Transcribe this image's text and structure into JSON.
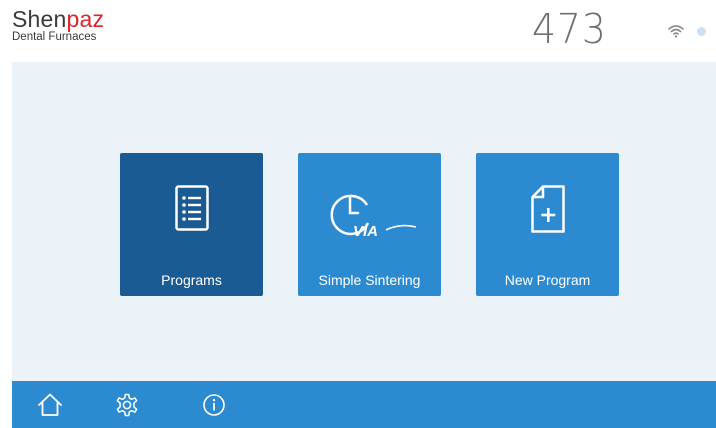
{
  "header": {
    "brand": {
      "name_main": "Shen",
      "name_accent": "paz",
      "subtitle": "Dental Furnaces"
    },
    "counter": "473",
    "icons": [
      "wifi-icon",
      "status-dot-icon"
    ]
  },
  "main": {
    "tiles": [
      {
        "label": "Programs",
        "icon": "list-document-icon",
        "color": "#1a5b93"
      },
      {
        "label": "Simple Sintering",
        "icon": "clock-via-icon",
        "icon_text": "VIA",
        "color": "#2b8ad0"
      },
      {
        "label": "New Program",
        "icon": "new-document-icon",
        "color": "#2b8ad0"
      }
    ]
  },
  "bottom_bar": {
    "buttons": [
      {
        "icon": "home-icon"
      },
      {
        "icon": "gear-icon"
      },
      {
        "icon": "info-icon"
      }
    ]
  },
  "colors": {
    "accent_red": "#d9262c",
    "primary_blue": "#2b8ad0",
    "dark_blue": "#1a5b93",
    "panel_bg": "#ebf2f8"
  }
}
